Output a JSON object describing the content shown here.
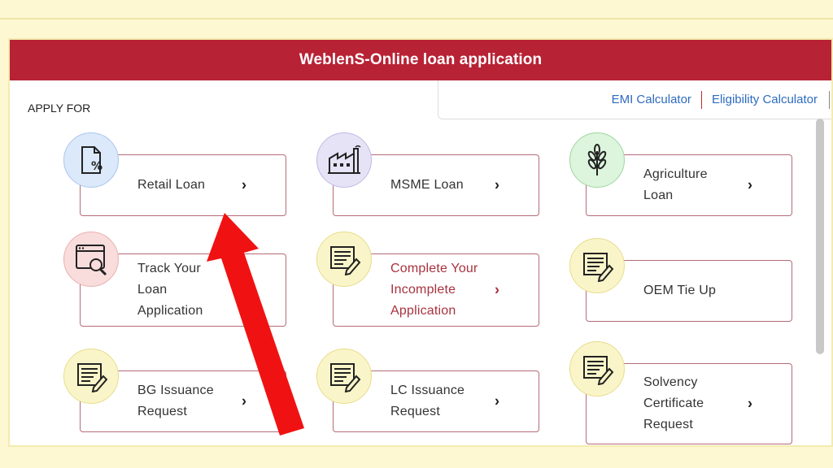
{
  "header": {
    "title": "WeblenS-Online loan application"
  },
  "apply_for": "APPLY FOR",
  "calculators": {
    "emi": "EMI Calculator",
    "eligibility": "Eligibility Calculator"
  },
  "colors": {
    "header_bg": "#b82235",
    "card_border": "#b66b78",
    "link": "#2e6bc0",
    "accent_text": "#a8323f",
    "page_bg": "#fdf7d2",
    "arrow": "#f01212"
  },
  "cards": [
    {
      "label": "Retail Loan",
      "icon": "document-percent-icon",
      "chevron": "›"
    },
    {
      "label": "MSME Loan",
      "icon": "factory-icon",
      "chevron": "›"
    },
    {
      "label": "Agriculture Loan",
      "icon": "wheat-icon",
      "chevron": "›"
    },
    {
      "label": "Track Your Loan Application",
      "icon": "browser-search-icon",
      "chevron": "›"
    },
    {
      "label": "Complete Your Incomplete Application",
      "icon": "form-pen-icon",
      "chevron": "›"
    },
    {
      "label": "OEM Tie Up",
      "icon": "form-pen-icon",
      "chevron": "›"
    },
    {
      "label": "BG Issuance Request",
      "icon": "form-pen-icon",
      "chevron": "›"
    },
    {
      "label": "LC Issuance Request",
      "icon": "form-pen-icon",
      "chevron": "›"
    },
    {
      "label": "Solvency Certificate Request",
      "icon": "form-pen-icon",
      "chevron": "›"
    }
  ]
}
